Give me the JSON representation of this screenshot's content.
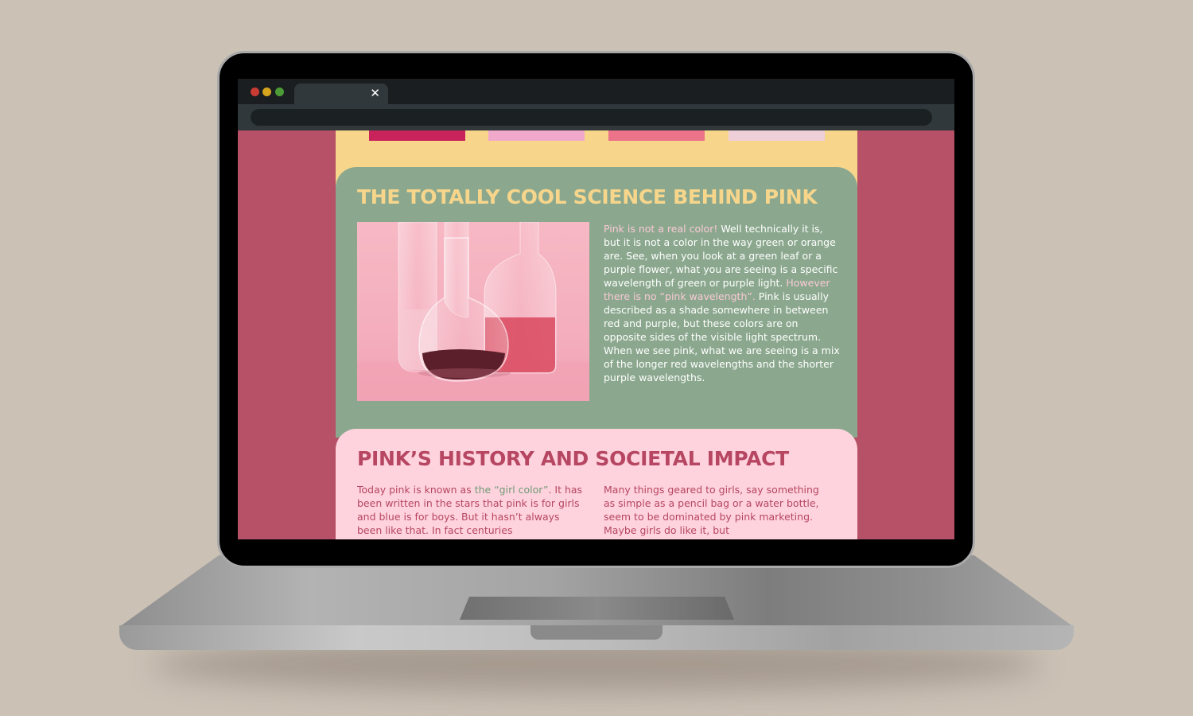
{
  "browser": {
    "tab_close_glyph": "✕",
    "address_value": ""
  },
  "palette": {
    "swatches": [
      "#c8235b",
      "#f1a9cb",
      "#ec7389",
      "#efcfd8"
    ],
    "page_bg": "#b75167",
    "yellow": "#f7d68c",
    "sage": "#8ba88e",
    "light_pink": "#fed3dd"
  },
  "science": {
    "title": "THE TOTALLY COOL SCIENCE BEHIND PINK",
    "highlight1": "Pink is not a real color!",
    "text1": " Well technically it is, but it is not a color in the way green or orange are. See, when you look at a green leaf or a purple flower, what you are seeing is a specific wavelength of green or purple light. ",
    "highlight2": "However there is no “pink wavelength”.",
    "text2": " Pink is usually described as a shade somewhere in between red and purple, but these colors are on opposite sides of the visible light spectrum. When we see pink, what we are seeing is a mix of the longer red wavelengths and the shorter purple wavelengths."
  },
  "history": {
    "title": "PINK’S HISTORY AND SOCIETAL IMPACT",
    "left_pre": "Today pink is known as ",
    "left_highlight": "the “girl color”",
    "left_post": ". It has been written in the stars that pink is for girls and blue is for boys. But it hasn’t always been like that. In fact centuries",
    "right": "Many things geared to girls, say something as simple as a pencil bag or a water bottle, seem to be dominated by pink marketing. Maybe girls do like it, but"
  }
}
